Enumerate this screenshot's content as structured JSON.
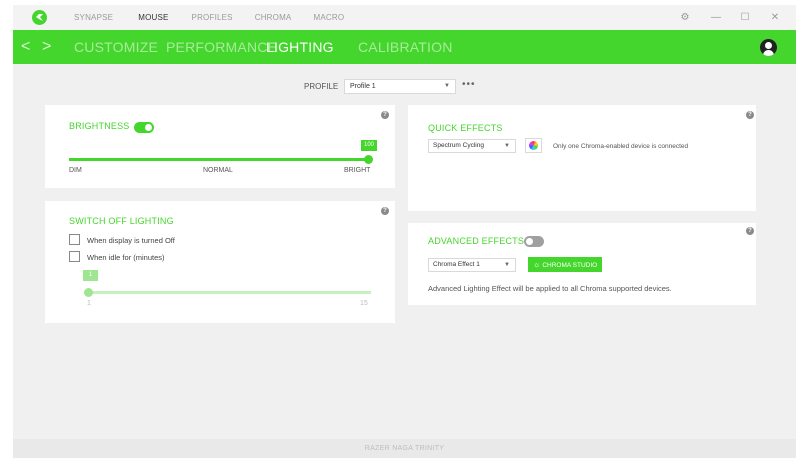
{
  "topnav": {
    "items": [
      "SYNAPSE",
      "MOUSE",
      "PROFILES",
      "CHROMA",
      "MACRO"
    ],
    "active": "MOUSE"
  },
  "window_controls": {
    "settings": "⚙",
    "minimize": "—",
    "maximize": "☐",
    "close": "✕"
  },
  "tabs": {
    "back": "<",
    "forward": ">",
    "items": [
      "CUSTOMIZE",
      "PERFORMANCE",
      "LIGHTING",
      "CALIBRATION"
    ],
    "active": "LIGHTING"
  },
  "profile": {
    "label": "PROFILE",
    "value": "Profile 1",
    "more": "•••"
  },
  "brightness": {
    "title": "BRIGHTNESS",
    "enabled": true,
    "value": "100",
    "level_fraction": 1.0,
    "min_label": "DIM",
    "mid_label": "NORMAL",
    "max_label": "BRIGHT"
  },
  "switch_off": {
    "title": "SWITCH OFF LIGHTING",
    "option_display": "When display is turned Off",
    "option_idle": "When idle for (minutes)",
    "display_checked": false,
    "idle_checked": false,
    "idle_value": "1",
    "idle_min": "1",
    "idle_max": "15"
  },
  "quick_effects": {
    "title": "QUICK EFFECTS",
    "selected": "Spectrum Cycling",
    "note": "Only one Chroma-enabled device is connected"
  },
  "advanced_effects": {
    "title": "ADVANCED EFFECTS",
    "enabled": false,
    "selected": "Chroma Effect 1",
    "studio_button": "CHROMA STUDIO",
    "note": "Advanced Lighting Effect will be applied to all Chroma supported devices."
  },
  "help_glyph": "?",
  "caret_glyph": "▼",
  "status": {
    "device": "RAZER NAGA TRINITY"
  },
  "colors": {
    "accent": "#44d62c",
    "background": "#f0f0f0",
    "card": "#ffffff"
  }
}
